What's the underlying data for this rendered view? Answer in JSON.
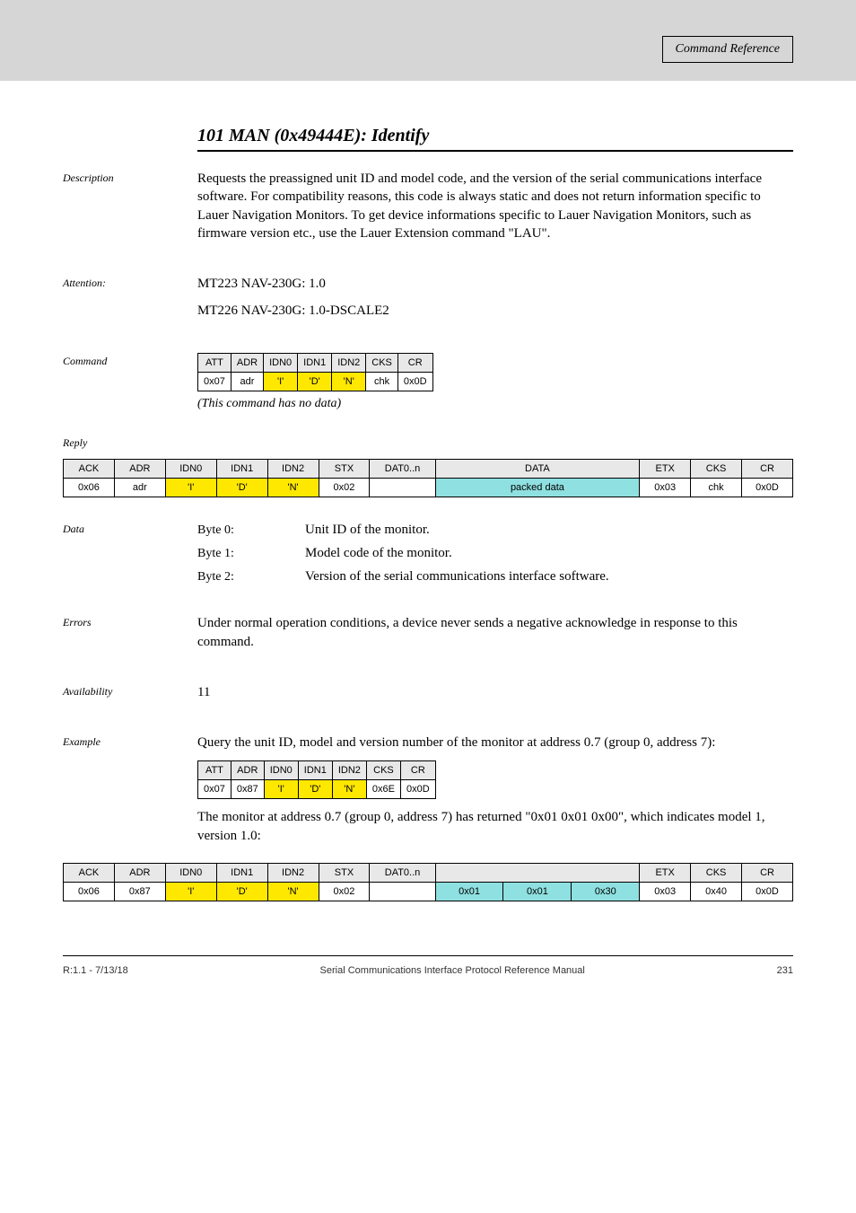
{
  "header": {
    "section": "Command Reference"
  },
  "cmd": {
    "id": "101",
    "name": "MAN (0x49444E): Identify",
    "title_line": "101 MAN (0x49444E): Identify",
    "labels": {
      "description": "Description",
      "attention": "Attention:",
      "command": "Command",
      "reply": "Reply",
      "data": "Data",
      "errors": "Errors",
      "availability": "Availability",
      "example": "Example"
    },
    "description": "Requests the preassigned unit ID and model code, and the version of the serial communications interface software. For compatibility reasons, this code is always static and does not return information specific to Lauer Navigation Monitors. To get device informations specific to Lauer Navigation Monitors, such as firmware version etc., use the Lauer Extension command \"LAU\".",
    "attention_lines": [
      "MT223 NAV-230G: 1.0",
      "MT226 NAV-230G: 1.0-DSCALE2"
    ],
    "command_table": {
      "headers": [
        "ATT",
        "ADR",
        "IDN0",
        "IDN1",
        "IDN2",
        "CKS",
        "CR"
      ],
      "row": [
        "0x07",
        "adr",
        "'I'",
        "'D'",
        "'N'",
        "chk",
        "0x0D"
      ]
    },
    "command_note": "(This command has no data)",
    "reply_table": {
      "headers": [
        "ACK",
        "ADR",
        "IDN0",
        "IDN1",
        "IDN2",
        "STX",
        "DAT0..n",
        "DATA",
        "ETX",
        "CKS",
        "CR"
      ],
      "row": [
        "0x06",
        "adr",
        "'I'",
        "'D'",
        "'N'",
        "0x02",
        "",
        "packed data",
        "0x03",
        "chk",
        "0x0D"
      ]
    },
    "data_fields": [
      {
        "label": "Byte 0:",
        "val": "Unit ID of the monitor."
      },
      {
        "label": "Byte 1:",
        "val": "Model code of the monitor."
      },
      {
        "label": "Byte 2:",
        "val": "Version of the serial communications interface software."
      }
    ],
    "errors_text": "Under normal operation conditions, a device never sends a negative acknowledge in response to this command.",
    "availability_text": "11",
    "example_intro": "Query the unit ID, model and version number of the monitor at address 0.7 (group 0, address 7):",
    "example_cmd_table": {
      "headers": [
        "ATT",
        "ADR",
        "IDN0",
        "IDN1",
        "IDN2",
        "CKS",
        "CR"
      ],
      "row": [
        "0x07",
        "0x87",
        "'I'",
        "'D'",
        "'N'",
        "0x6E",
        "0x0D"
      ]
    },
    "example_reply_intro": "The monitor at address 0.7 (group 0, address 7) has returned \"0x01 0x01 0x00\", which indicates model 1, version 1.0:",
    "example_reply_table": {
      "headers": [
        "ACK",
        "ADR",
        "IDN0",
        "IDN1",
        "IDN2",
        "STX",
        "DAT0..n",
        "",
        "",
        "",
        "ETX",
        "CKS",
        "CR"
      ],
      "row": [
        "0x06",
        "0x87",
        "'I'",
        "'D'",
        "'N'",
        "0x02",
        "",
        "0x01",
        "0x01",
        "0x30",
        "0x03",
        "0x40",
        "0x0D"
      ]
    }
  },
  "footer": {
    "left": "R:1.1 - 7/13/18",
    "center": "Serial Communications Interface Protocol Reference Manual",
    "right": "231"
  }
}
